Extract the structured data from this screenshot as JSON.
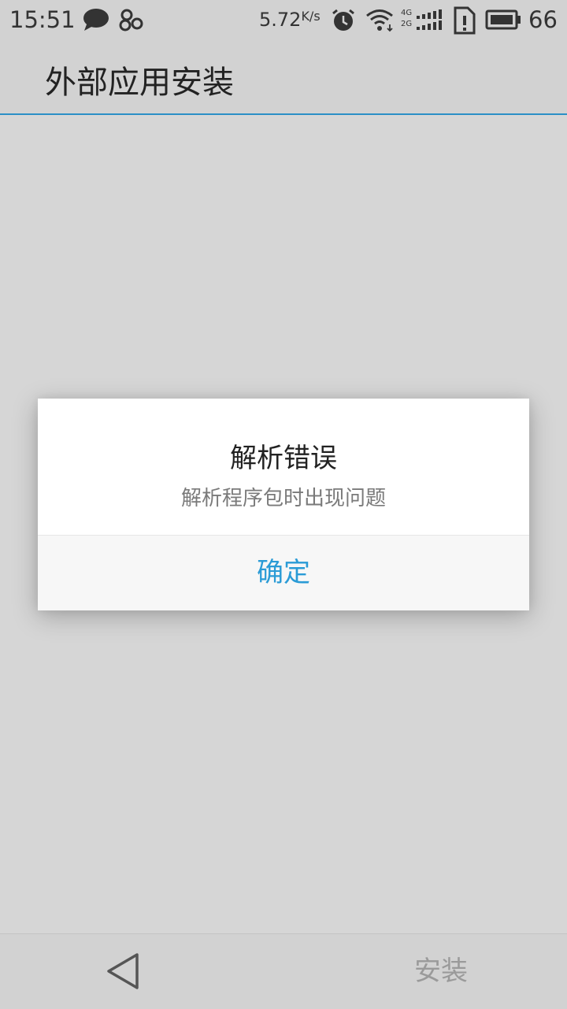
{
  "status_bar": {
    "time": "15:51",
    "speed": "5.72",
    "speed_unit": "K/s",
    "network_top": "4G",
    "network_bottom": "2G",
    "battery_level": "66",
    "icons": [
      "message-icon",
      "pinwheel-icon",
      "alarm-icon",
      "wifi-icon",
      "signal-icon",
      "sim-icon",
      "battery-icon"
    ]
  },
  "app_bar": {
    "title": "外部应用安装",
    "accent_color": "#2b8fc6"
  },
  "dialog": {
    "title": "解析错误",
    "message": "解析程序包时出现问题",
    "ok_label": "确定",
    "ok_color": "#2a9bd6"
  },
  "bottom_bar": {
    "back_icon": "back-triangle-icon",
    "install_label": "安装"
  }
}
